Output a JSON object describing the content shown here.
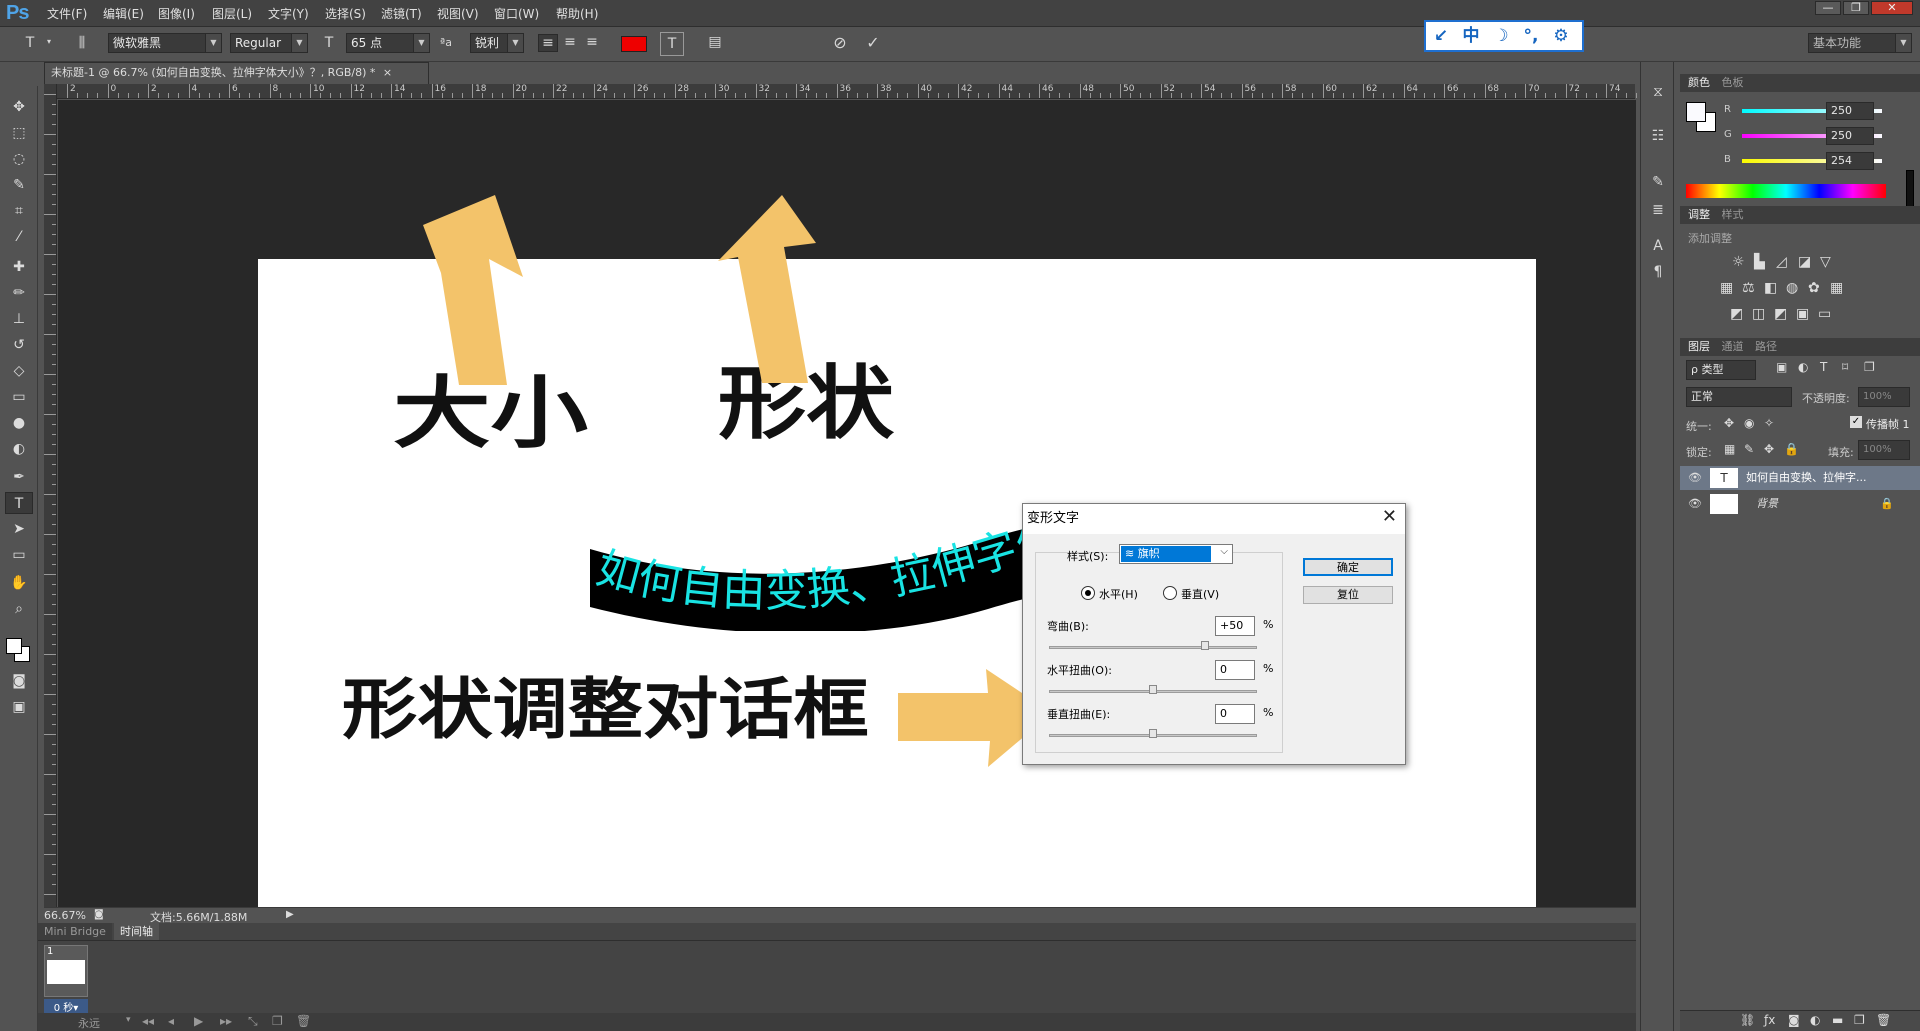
{
  "app": {
    "logo": "Ps"
  },
  "menu": [
    "文件(F)",
    "编辑(E)",
    "图像(I)",
    "图层(L)",
    "文字(Y)",
    "选择(S)",
    "滤镜(T)",
    "视图(V)",
    "窗口(W)",
    "帮助(H)"
  ],
  "window_controls": {
    "minimize": "—",
    "restore": "❐",
    "close": "✕"
  },
  "options": {
    "font_family": "微软雅黑",
    "font_style": "Regular",
    "font_size": "65 点",
    "aa_label": "ªa",
    "antialias": "锐利",
    "text_color": "#ee0000",
    "workspace": "基本功能"
  },
  "ime_icons": [
    "↙",
    "中",
    "☽",
    "°,",
    "⚙"
  ],
  "doc_tab": {
    "title": "未标题-1 @ 66.7% (如何自由变换、拉伸字体大小》？, RGB/8) *",
    "close": "×"
  },
  "ruler_labels": [
    "2",
    "0",
    "2",
    "4",
    "6",
    "8",
    "10",
    "12",
    "14",
    "16",
    "18",
    "20",
    "22",
    "24",
    "26",
    "28",
    "30",
    "32",
    "34",
    "36",
    "38",
    "40",
    "42",
    "44",
    "46",
    "48",
    "50",
    "52",
    "54",
    "56",
    "58",
    "60",
    "62",
    "64",
    "66",
    "68",
    "70",
    "72",
    "74"
  ],
  "canvas": {
    "label_size": "大小",
    "label_shape": "形状",
    "label_dialog": "形状调整对话框",
    "warped_text": "如何自由变换、拉伸字体大小》？",
    "warped_text_color": "#19e3e3",
    "arrow_color": "#f3c36a"
  },
  "dialog": {
    "title": "变形文字",
    "close": "✕",
    "style_label": "样式(S):",
    "style_value": "旗帜",
    "orient_h": "水平(H)",
    "orient_v": "垂直(V)",
    "bend_label": "弯曲(B):",
    "bend_value": "+50",
    "bend_level": 0.75,
    "h_distort_label": "水平扭曲(O):",
    "h_distort_value": "0",
    "v_distort_label": "垂直扭曲(E):",
    "v_distort_value": "0",
    "percent": "%",
    "ok": "确定",
    "reset": "复位"
  },
  "status": {
    "zoom": "66.67%",
    "doc": "文档:5.66M/1.88M"
  },
  "timeline": {
    "tabs": [
      "Mini Bridge",
      "时间轴"
    ],
    "frame_number": "1",
    "frame_time": "0 秒▾",
    "loop": "永远"
  },
  "color_panel": {
    "tabs": [
      "颜色",
      "色板"
    ],
    "channels": [
      {
        "label": "R",
        "value": "250"
      },
      {
        "label": "G",
        "value": "250"
      },
      {
        "label": "B",
        "value": "254"
      }
    ]
  },
  "adjust_panel": {
    "tabs": [
      "调整",
      "样式"
    ],
    "heading": "添加调整"
  },
  "layers_panel": {
    "tabs": [
      "图层",
      "通道",
      "路径"
    ],
    "filter": "ρ 类型",
    "blend": "正常",
    "opacity_label": "不透明度:",
    "opacity": "100%",
    "unify_label": "统一:",
    "propagate": "传播帧 1",
    "lock_label": "锁定:",
    "fill_label": "填充:",
    "fill": "100%",
    "layers": [
      {
        "name": "如何自由变换、拉伸字...",
        "type": "text"
      },
      {
        "name": "背景",
        "type": "background"
      }
    ]
  }
}
